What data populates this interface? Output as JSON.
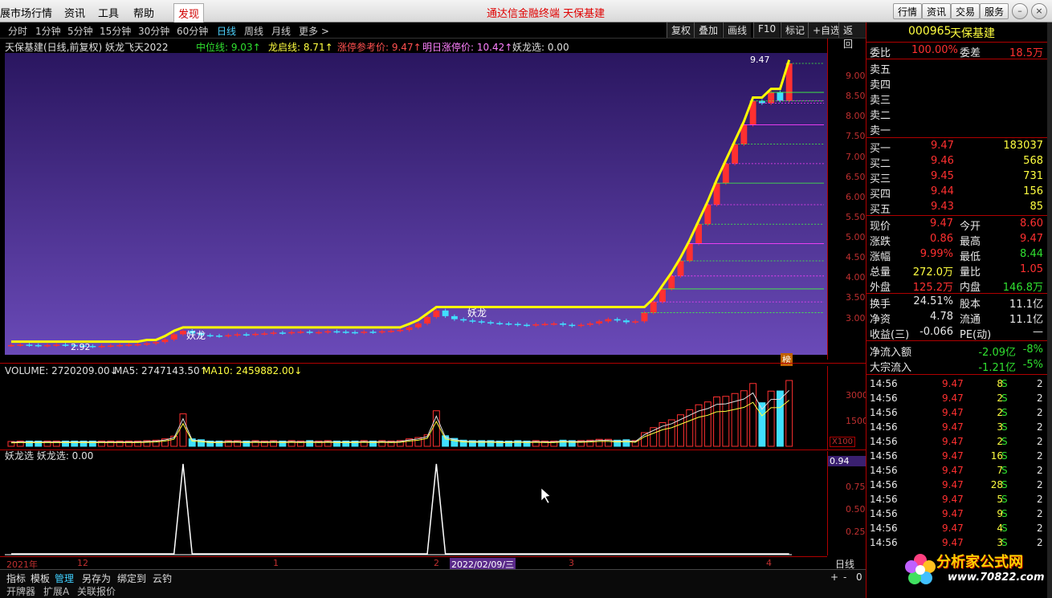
{
  "menu": {
    "items": [
      "展市场行情",
      "资讯",
      "工具",
      "帮助"
    ],
    "discover": "发现",
    "center_title": "通达信金融终端    天保基建",
    "right_buttons": [
      "行情",
      "资讯",
      "交易",
      "服务"
    ]
  },
  "periods": [
    "分时",
    "1分钟",
    "5分钟",
    "15分钟",
    "30分钟",
    "60分钟",
    "日线",
    "周线",
    "月线",
    "更多 >"
  ],
  "active_period": "日线",
  "tools": [
    "复权",
    "叠加",
    "画线",
    "F10",
    "标记",
    "+自选",
    "返回"
  ],
  "info": {
    "name": "天保基建(日线,前复权) 妖龙飞天2022",
    "mid": "中位线: 9.03↑",
    "dragon": "龙启线: 8.71↑",
    "limit_ref": "涨停参考价: 9.47↑",
    "next_limit": "明日涨停价: 10.42↑",
    "select": "妖龙选: 0.00"
  },
  "chart_labels": {
    "high_label": "9.47",
    "low_label": "2.92",
    "yao1": "妖龙",
    "yao2": "妖龙",
    "bang": "榜"
  },
  "price_ticks": [
    "9.00",
    "8.50",
    "8.00",
    "7.50",
    "7.00",
    "6.50",
    "6.00",
    "5.50",
    "5.00",
    "4.50",
    "4.00",
    "3.50",
    "3.00"
  ],
  "volume": {
    "vol": "VOLUME: 2720209.00↓",
    "ma5": "MA5: 2747143.50↑",
    "ma10": "MA10: 2459882.00↓",
    "ticks": [
      "30000",
      "15000"
    ],
    "unit": "X100"
  },
  "indicator": {
    "label": "妖龙选  妖龙选: 0.00",
    "current": "0.94",
    "ticks": [
      "0.75",
      "0.50",
      "0.25"
    ]
  },
  "time_axis": {
    "year": "2021年",
    "m12": "12",
    "m1": "1",
    "m2": "2",
    "current": "2022/02/09/三",
    "m3": "3",
    "m4": "4",
    "period": "日线"
  },
  "bottom": [
    "指标",
    "模板",
    "管理",
    "另存为",
    "绑定到",
    "云钓"
  ],
  "bottom2": [
    "开牌器",
    "扩展A",
    "关联报价"
  ],
  "right_panel": {
    "code": "000965",
    "name": "天保基建",
    "weibi_label": "委比",
    "weibi": "100.00%",
    "weicha_label": "委差",
    "weicha": "18.5万",
    "sells": [
      "卖五",
      "卖四",
      "卖三",
      "卖二",
      "卖一"
    ],
    "buys": [
      {
        "label": "买一",
        "price": "9.47",
        "vol": "183037"
      },
      {
        "label": "买二",
        "price": "9.46",
        "vol": "568"
      },
      {
        "label": "买三",
        "price": "9.45",
        "vol": "731"
      },
      {
        "label": "买四",
        "price": "9.44",
        "vol": "156"
      },
      {
        "label": "买五",
        "price": "9.43",
        "vol": "85"
      }
    ],
    "stats": [
      {
        "l1": "现价",
        "v1": "9.47",
        "c1": "red",
        "l2": "今开",
        "v2": "8.60",
        "c2": "red"
      },
      {
        "l1": "涨跌",
        "v1": "0.86",
        "c1": "red",
        "l2": "最高",
        "v2": "9.47",
        "c2": "red"
      },
      {
        "l1": "涨幅",
        "v1": "9.99%",
        "c1": "red",
        "l2": "最低",
        "v2": "8.44",
        "c2": "green"
      },
      {
        "l1": "总量",
        "v1": "272.0万",
        "c1": "yellow",
        "l2": "量比",
        "v2": "1.05",
        "c2": "red"
      },
      {
        "l1": "外盘",
        "v1": "125.2万",
        "c1": "red",
        "l2": "内盘",
        "v2": "146.8万",
        "c2": "green"
      }
    ],
    "stats2": [
      {
        "l1": "换手",
        "v1": "24.51%",
        "l2": "股本",
        "v2": "11.1亿"
      },
      {
        "l1": "净资",
        "v1": "4.78",
        "l2": "流通",
        "v2": "11.1亿"
      },
      {
        "l1": "收益(三)",
        "v1": "-0.066",
        "l2": "PE(动)",
        "v2": "—"
      }
    ],
    "flow": [
      {
        "l": "净流入额",
        "v": "-2.09亿",
        "p": "-8%"
      },
      {
        "l": "大宗流入",
        "v": "-1.21亿",
        "p": "-5%"
      }
    ],
    "ticks": [
      {
        "t": "14:56",
        "p": "9.47",
        "v": "8",
        "s": "S",
        "n": "2"
      },
      {
        "t": "14:56",
        "p": "9.47",
        "v": "2",
        "s": "S",
        "n": "2"
      },
      {
        "t": "14:56",
        "p": "9.47",
        "v": "2",
        "s": "S",
        "n": "2"
      },
      {
        "t": "14:56",
        "p": "9.47",
        "v": "3",
        "s": "S",
        "n": "2"
      },
      {
        "t": "14:56",
        "p": "9.47",
        "v": "2",
        "s": "S",
        "n": "2"
      },
      {
        "t": "14:56",
        "p": "9.47",
        "v": "16",
        "s": "S",
        "n": "2"
      },
      {
        "t": "14:56",
        "p": "9.47",
        "v": "7",
        "s": "S",
        "n": "2"
      },
      {
        "t": "14:56",
        "p": "9.47",
        "v": "28",
        "s": "S",
        "n": "2"
      },
      {
        "t": "14:56",
        "p": "9.47",
        "v": "5",
        "s": "S",
        "n": "2"
      },
      {
        "t": "14:56",
        "p": "9.47",
        "v": "9",
        "s": "S",
        "n": "2"
      },
      {
        "t": "14:56",
        "p": "9.47",
        "v": "4",
        "s": "S",
        "n": "2"
      },
      {
        "t": "14:56",
        "p": "9.47",
        "v": "3",
        "s": "S",
        "n": "2"
      }
    ]
  },
  "logo": {
    "title": "分析家公式网",
    "url": "www.70822.com"
  },
  "chart_data": {
    "type": "candlestick",
    "closes": [
      2.95,
      2.96,
      2.95,
      2.94,
      2.95,
      2.96,
      2.95,
      2.94,
      2.93,
      2.92,
      2.93,
      2.94,
      2.95,
      2.96,
      2.97,
      2.99,
      3.02,
      3.08,
      3.2,
      3.28,
      3.22,
      3.18,
      3.17,
      3.16,
      3.18,
      3.2,
      3.19,
      3.21,
      3.22,
      3.24,
      3.23,
      3.25,
      3.26,
      3.24,
      3.25,
      3.27,
      3.26,
      3.25,
      3.24,
      3.26,
      3.25,
      3.27,
      3.28,
      3.3,
      3.36,
      3.45,
      3.6,
      3.75,
      3.62,
      3.55,
      3.52,
      3.5,
      3.48,
      3.46,
      3.45,
      3.44,
      3.42,
      3.41,
      3.43,
      3.44,
      3.45,
      3.42,
      3.4,
      3.42,
      3.45,
      3.5,
      3.55,
      3.52,
      3.48,
      3.5,
      3.7,
      3.95,
      4.25,
      4.55,
      4.9,
      5.3,
      5.75,
      6.2,
      6.7,
      7.15,
      7.6,
      8.05,
      8.6,
      8.55,
      8.8,
      8.61,
      9.47
    ],
    "ylim": [
      2.8,
      9.6
    ],
    "series": [
      {
        "name": "中位线",
        "values": [
          9.03
        ]
      },
      {
        "name": "龙启线",
        "values": [
          8.71
        ]
      }
    ]
  }
}
